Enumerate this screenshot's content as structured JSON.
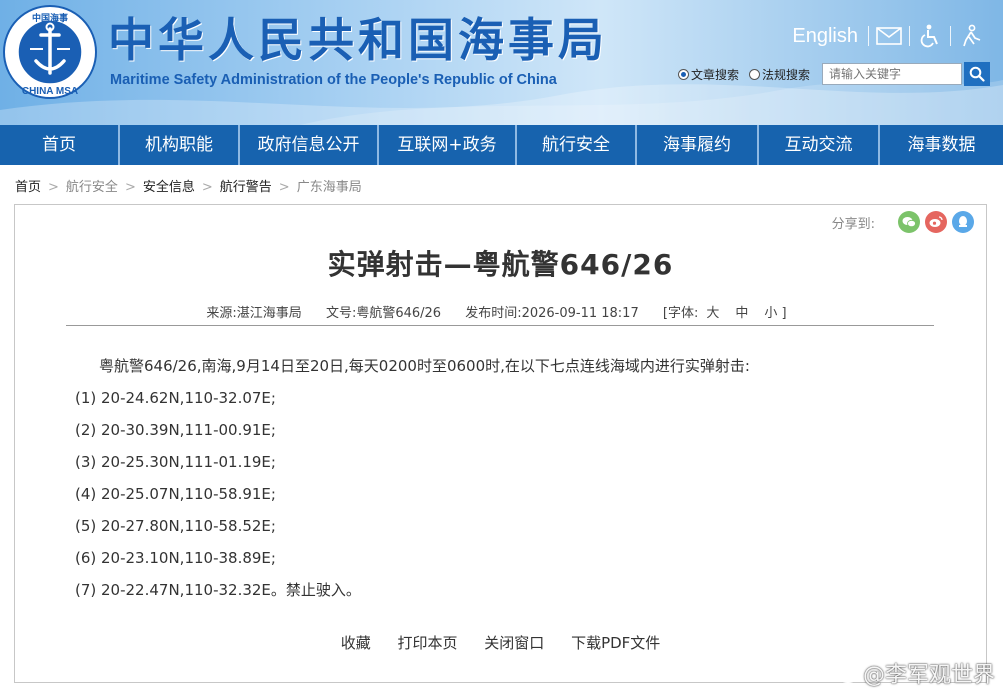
{
  "header": {
    "emblem_top_text": "中国海事",
    "emblem_bottom_text": "CHINA MSA",
    "title": "中华人民共和国海事局",
    "subtitle": "Maritime Safety Administration of the People's Republic of China",
    "english_link": "English",
    "icons": [
      "mail-icon",
      "accessibility-icon",
      "elder-care-icon"
    ]
  },
  "search": {
    "option_article": "文章搜索",
    "option_law": "法规搜索",
    "selected": "文章搜索",
    "placeholder": "请输入关键字"
  },
  "nav": {
    "items": [
      "首页",
      "机构职能",
      "政府信息公开",
      "互联网+政务",
      "航行安全",
      "海事履约",
      "互动交流",
      "海事数据"
    ]
  },
  "breadcrumb": [
    "首页",
    "航行安全",
    "安全信息",
    "航行警告",
    "广东海事局"
  ],
  "article": {
    "share_label": "分享到:",
    "share_icons": [
      "wechat-icon",
      "weibo-icon",
      "qq-icon"
    ],
    "title": "实弹射击—粤航警646/26",
    "meta": {
      "source": "来源:湛江海事局",
      "doc_no": "文号:粤航警646/26",
      "publish_time": "发布时间:2026-09-11 18:17",
      "font_label": "[字体:",
      "font_large": "大",
      "font_medium": "中",
      "font_small": "小 ]"
    },
    "lead": "粤航警646/26,南海,9月14日至20日,每天0200时至0600时,在以下七点连线海域内进行实弹射击:",
    "points": [
      "(1) 20-24.62N,110-32.07E;",
      "(2) 20-30.39N,111-00.91E;",
      "(3) 20-25.30N,111-01.19E;",
      "(4) 20-25.07N,110-58.91E;",
      "(5) 20-27.80N,110-58.52E;",
      "(6) 20-23.10N,110-38.89E;",
      "(7) 20-22.47N,110-32.32E。禁止驶入。"
    ],
    "actions": [
      "收藏",
      "打印本页",
      "关闭窗口",
      "下载PDF文件"
    ]
  },
  "watermark": "@李军观世界",
  "colors": {
    "nav_bg": "#1763ae",
    "title_blue": "#1a5fb4",
    "wechat": "#7cc36a",
    "weibo": "#e5665f",
    "qq": "#5aa8e8"
  }
}
